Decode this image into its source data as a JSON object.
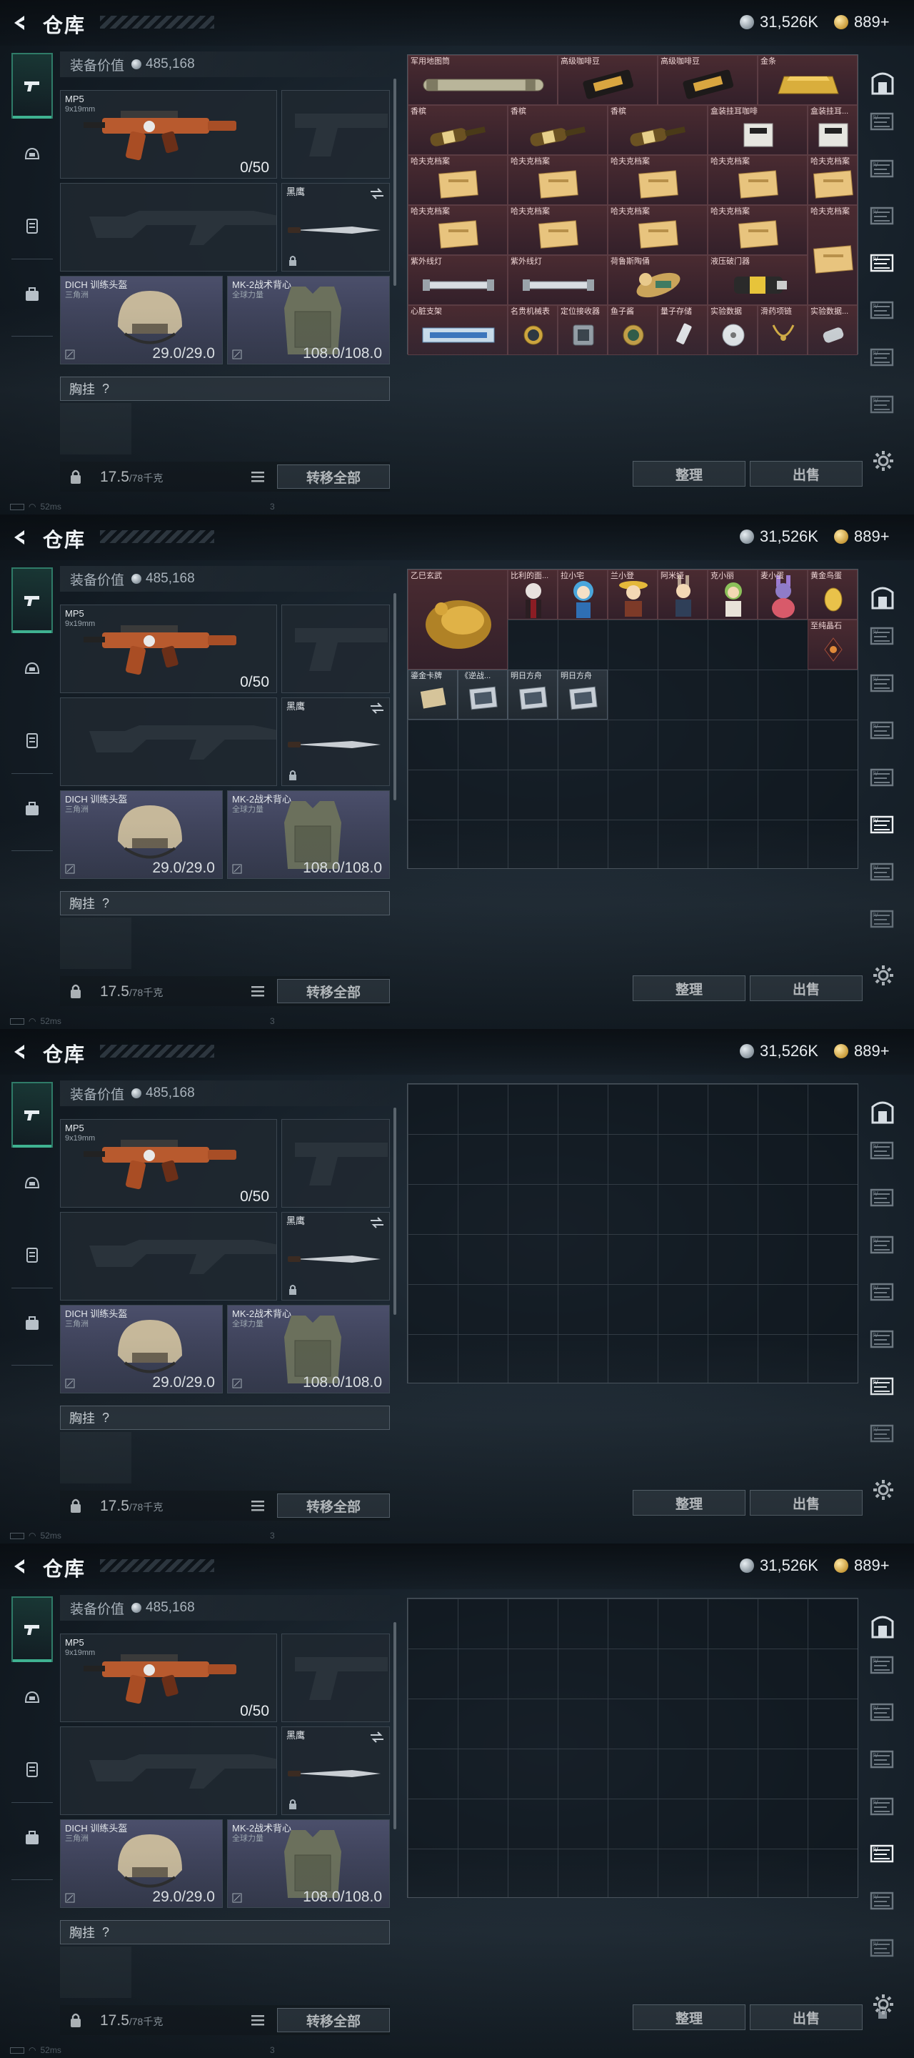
{
  "page": {
    "title": "仓库"
  },
  "currency": {
    "silver": "31,526K",
    "gold": "889+"
  },
  "colors": {
    "accent": "#3fb291",
    "rare": "#5b3c43",
    "epic": "#4b4f6b"
  },
  "equip": {
    "value_label": "装备价值",
    "value": "485,168",
    "primary": {
      "name": "MP5",
      "caliber": "9x19mm",
      "ammo": "0/50"
    },
    "melee": {
      "name": "黑鹰"
    },
    "helmet": {
      "name": "DICH 训练头盔",
      "sub": "三角洲",
      "durability": "29.0/29.0"
    },
    "armor": {
      "name": "MK-2战术背心",
      "sub": "全球力量",
      "durability": "108.0/108.0"
    },
    "chest": {
      "label": "胸挂",
      "hint": "?"
    }
  },
  "footer": {
    "weight": "17.5",
    "weight_max": "/78千克",
    "transfer": "转移全部",
    "sort": "整理",
    "sell": "出售"
  },
  "status": {
    "ping": "52ms",
    "page_no": "3"
  },
  "icons": {
    "back": "back-arrow-icon",
    "tabs": [
      "gun-icon",
      "helmet-tab-icon",
      "vest-tab-icon",
      "backpack-tab-icon"
    ],
    "right": [
      "vault-icon",
      "storage-box-icon",
      "lock-icon",
      "settings-gear-icon"
    ]
  },
  "grids": [
    {
      "items": [
        {
          "label": "军用地图筒",
          "tone": "rare",
          "art": "tube"
        },
        {
          "label": "高级咖啡豆",
          "tone": "rare",
          "art": "bag"
        },
        {
          "label": "高级咖啡豆",
          "tone": "rare",
          "art": "bag"
        },
        {
          "label": "金条",
          "tone": "rare",
          "art": "gold"
        },
        {
          "label": "香槟",
          "tone": "rare",
          "art": "bottle"
        },
        {
          "label": "香槟",
          "tone": "rare",
          "art": "bottle"
        },
        {
          "label": "香槟",
          "tone": "rare",
          "art": "bottle"
        },
        {
          "label": "盒装挂耳咖啡",
          "tone": "rare",
          "art": "box"
        },
        {
          "label": "盒装挂耳...",
          "tone": "rare",
          "art": "box"
        },
        {
          "label": "哈夫克档案",
          "tone": "rare",
          "art": "file"
        },
        {
          "label": "哈夫克档案",
          "tone": "rare",
          "art": "file"
        },
        {
          "label": "哈夫克档案",
          "tone": "rare",
          "art": "file"
        },
        {
          "label": "哈夫克档案",
          "tone": "rare",
          "art": "file"
        },
        {
          "label": "哈夫克档案",
          "tone": "rare",
          "art": "file"
        },
        {
          "label": "哈夫克档案",
          "tone": "rare",
          "art": "file"
        },
        {
          "label": "哈夫克档案",
          "tone": "rare",
          "art": "file"
        },
        {
          "label": "哈夫克档案",
          "tone": "rare",
          "art": "file"
        },
        {
          "label": "哈夫克档案",
          "tone": "rare",
          "art": "file"
        },
        {
          "label": "哈夫克档案",
          "tone": "rare",
          "art": "file"
        },
        {
          "label": "紫外线灯",
          "tone": "rare",
          "art": "lamp"
        },
        {
          "label": "紫外线灯",
          "tone": "rare",
          "art": "lamp"
        },
        {
          "label": "荷鲁斯陶俑",
          "tone": "rare",
          "art": "figure"
        },
        {
          "label": "液压破门器",
          "tone": "rare",
          "art": "drill"
        },
        {
          "label": "心脏支架",
          "tone": "rare",
          "art": "stent"
        },
        {
          "label": "名贵机械表",
          "tone": "rare",
          "art": "watch"
        },
        {
          "label": "定位接收器",
          "tone": "rare",
          "art": "device"
        },
        {
          "label": "鱼子酱",
          "tone": "rare",
          "art": "can"
        },
        {
          "label": "量子存储",
          "tone": "rare",
          "art": "usb"
        },
        {
          "label": "实验数据",
          "tone": "rare",
          "art": "disc"
        },
        {
          "label": "滑药项链",
          "tone": "rare",
          "art": "necklace"
        },
        {
          "label": "实验数据...",
          "tone": "rare",
          "art": "whistle"
        }
      ]
    },
    {
      "items": [
        {
          "label": "乙巳玄武",
          "tone": "rare",
          "art": "dragon"
        },
        {
          "label": "比利的面...",
          "tone": "rare",
          "art": "doll"
        },
        {
          "label": "拉小宅",
          "tone": "rare",
          "art": "doll2"
        },
        {
          "label": "兰小登",
          "tone": "rare",
          "art": "doll3"
        },
        {
          "label": "阿米娅",
          "tone": "rare",
          "art": "doll4"
        },
        {
          "label": "克小丽",
          "tone": "rare",
          "art": "doll5"
        },
        {
          "label": "麦小蛋",
          "tone": "rare",
          "art": "doll6"
        },
        {
          "label": "黄金鸟蛋",
          "tone": "rare",
          "art": "egg"
        },
        {
          "label": "至纯晶石",
          "tone": "rare",
          "art": "crystal"
        },
        {
          "label": "鎏金卡牌",
          "tone": "gray",
          "art": "card"
        },
        {
          "label": "《逆战...",
          "tone": "gray",
          "art": "card2"
        },
        {
          "label": "明日方舟",
          "tone": "gray",
          "art": "card2"
        },
        {
          "label": "明日方舟",
          "tone": "gray",
          "art": "card2"
        }
      ]
    },
    {
      "items": []
    },
    {
      "items": []
    }
  ]
}
